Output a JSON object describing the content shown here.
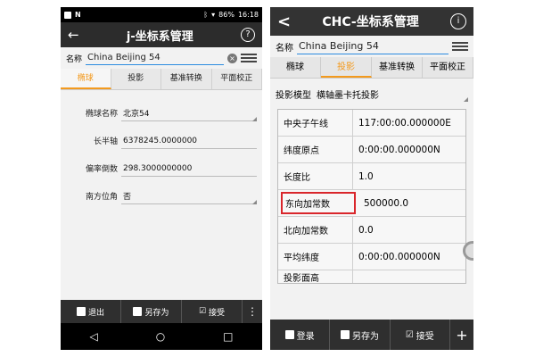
{
  "left": {
    "status": {
      "battery": "86%",
      "time": "16:18"
    },
    "title": "j-坐标系管理",
    "help": "?",
    "name_label": "名称",
    "name_value": "China Beijing 54",
    "tabs": [
      "椭球",
      "投影",
      "基准转换",
      "平面校正"
    ],
    "fields": [
      {
        "label": "椭球名称",
        "value": "北京54"
      },
      {
        "label": "长半轴",
        "value": "6378245.0000000"
      },
      {
        "label": "偏率倒数",
        "value": "298.3000000000"
      },
      {
        "label": "南方位角",
        "value": "否"
      }
    ],
    "bottom": {
      "exit": "退出",
      "saveas": "另存为",
      "accept": "接受",
      "more": "⋮"
    },
    "nav": {
      "back": "◁",
      "home": "○",
      "recent": "□"
    }
  },
  "right": {
    "back": "<",
    "title": "CHC-坐标系管理",
    "info": "i",
    "name_label": "名称",
    "name_value": "China Beijing 54",
    "tabs": [
      "椭球",
      "投影",
      "基准转换",
      "平面校正"
    ],
    "model_label": "投影模型",
    "model_value": "横轴墨卡托投影",
    "params": [
      {
        "label": "中央子午线",
        "value": "117:00:00.000000E"
      },
      {
        "label": "纬度原点",
        "value": "0:00:00.000000N"
      },
      {
        "label": "长度比",
        "value": "1.0"
      },
      {
        "label": "东向加常数",
        "value": "500000.0"
      },
      {
        "label": "北向加常数",
        "value": "0.0"
      },
      {
        "label": "平均纬度",
        "value": "0:00:00.000000N"
      },
      {
        "label": "投影面高",
        "value": ""
      }
    ],
    "bottom": {
      "login": "登录",
      "saveas": "另存为",
      "accept": "接受",
      "plus": "+"
    }
  },
  "colors": {
    "accent": "#f39a1e",
    "highlight": "#d9262b",
    "input_line": "#2b8be0",
    "bar": "#2f2f2f"
  }
}
